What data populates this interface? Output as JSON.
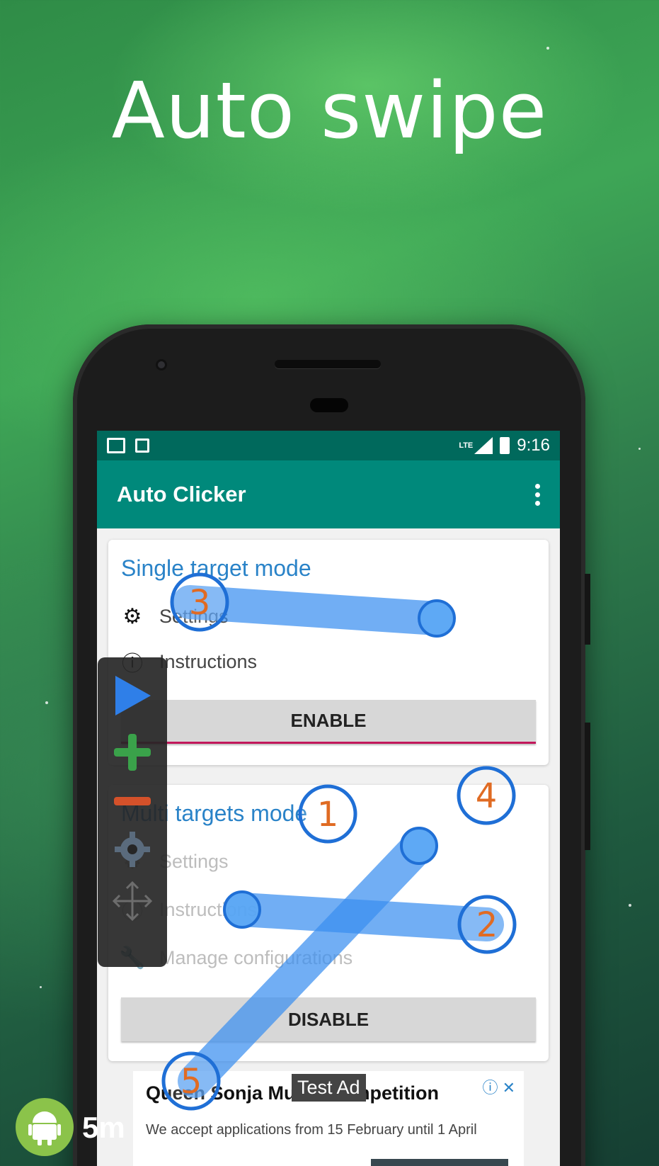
{
  "headline": "Auto swipe",
  "status_bar": {
    "time": "9:16",
    "network": "LTE",
    "left_icons": [
      "gmail-icon",
      "notification-icon"
    ]
  },
  "app_bar": {
    "title": "Auto Clicker",
    "menu_icon": "overflow-menu-icon"
  },
  "single_mode": {
    "title": "Single target mode",
    "settings": "Settings",
    "instructions": "Instructions",
    "button": "ENABLE"
  },
  "multi_mode": {
    "title": "Multi targets mode",
    "settings": "Settings",
    "instructions": "Instructions",
    "manage": "Manage configurations",
    "button": "DISABLE"
  },
  "toolbar": {
    "items": [
      "play-icon",
      "plus-icon",
      "minus-icon",
      "gear-icon",
      "move-icon"
    ]
  },
  "targets": {
    "labels": [
      "1",
      "2",
      "3",
      "4",
      "5"
    ]
  },
  "ad": {
    "badge": "Test Ad",
    "title": "Queen Sonja Music Competition",
    "subtitle": "We accept applications from 15 February until 1 April",
    "info_icon": "adchoices-icon"
  },
  "watermark": {
    "text": "5m",
    "icon": "android-icon"
  },
  "colors": {
    "status_bar": "#00695c",
    "app_bar": "#00897b",
    "accent_title": "#2a83c8",
    "swipe": "#3a8ff0",
    "target_label": "#e06b23"
  }
}
